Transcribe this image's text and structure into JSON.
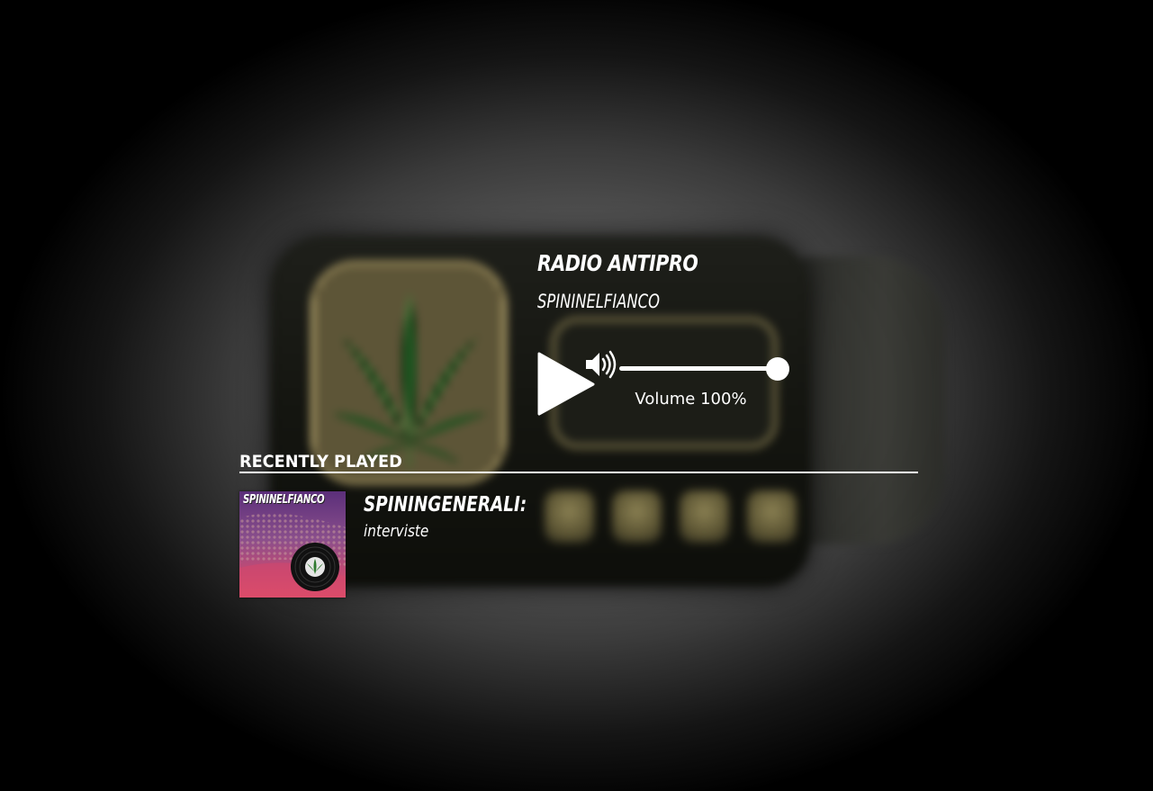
{
  "player": {
    "station_title": "RADIO ANTIPRO",
    "station_subtitle": "SPININELFIANCO",
    "play_icon": "play-icon",
    "volume_icon": "speaker-volume-icon",
    "volume_percent": 100,
    "volume_label": "Volume 100%"
  },
  "recently_played": {
    "header": "RECENTLY PLAYED",
    "items": [
      {
        "title": "SPININGENERALI:",
        "subtitle": "interviste",
        "cover_label": "SPININELFIANCO"
      }
    ]
  },
  "colors": {
    "text": "#ffffff",
    "leaf": "#1f5a22",
    "cover_top": "#6b3f8f",
    "cover_bottom": "#d8456a"
  }
}
